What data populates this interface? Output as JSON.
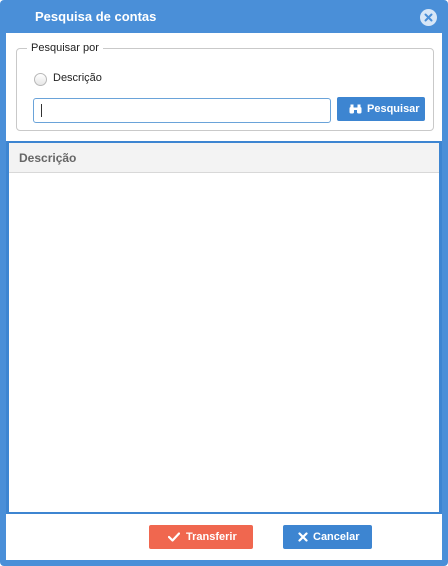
{
  "dialog": {
    "title": "Pesquisa de contas",
    "close_icon": "close-circle-icon"
  },
  "search": {
    "legend": "Pesquisar por",
    "radio_label": "Descrição",
    "input_value": "",
    "button_label": "Pesquisar",
    "button_icon": "binoculars-icon"
  },
  "grid": {
    "columns": [
      "Descrição"
    ],
    "rows": []
  },
  "footer": {
    "transfer_label": "Transferir",
    "transfer_icon": "check-icon",
    "cancel_label": "Cancelar",
    "cancel_icon": "x-icon"
  },
  "colors": {
    "frame": "#4a8fd8",
    "primary_button": "#3d85d1",
    "transfer_button": "#f0674f"
  }
}
